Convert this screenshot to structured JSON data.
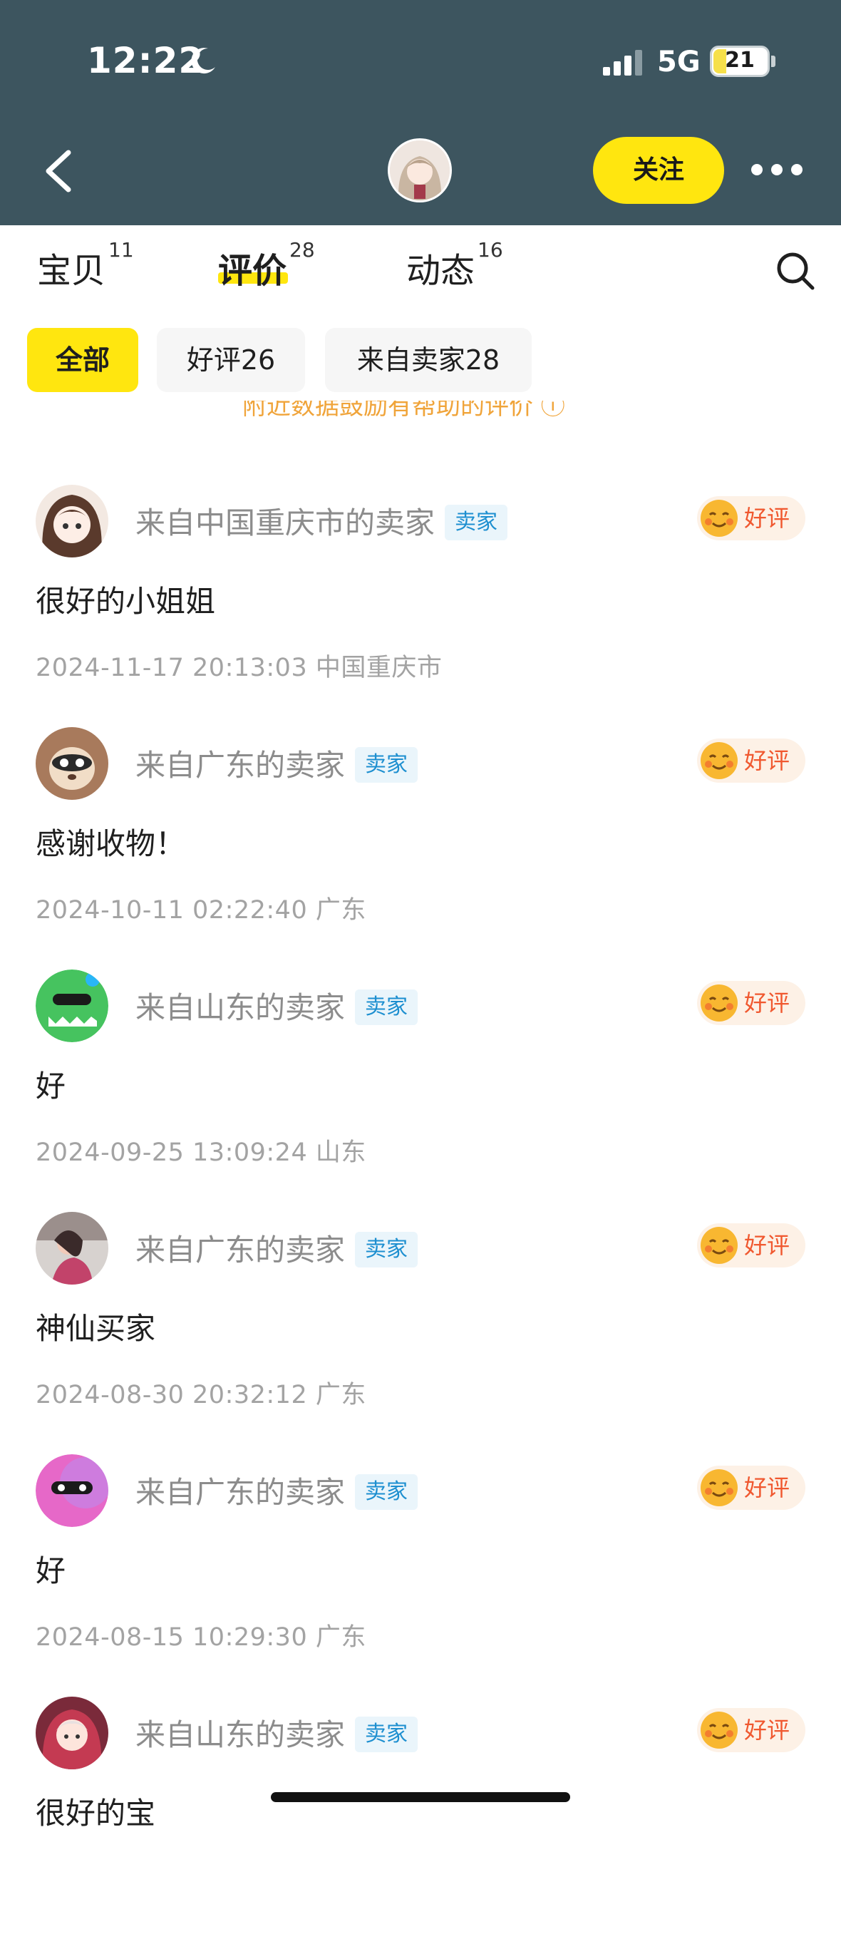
{
  "status_bar": {
    "time": "12:22",
    "network": "5G",
    "battery": "21"
  },
  "header": {
    "follow_label": "关注"
  },
  "tabs": [
    {
      "label": "宝贝",
      "count": "11"
    },
    {
      "label": "评价",
      "count": "28"
    },
    {
      "label": "动态",
      "count": "16"
    }
  ],
  "filters": [
    "全部",
    "好评26",
    "来自卖家28"
  ],
  "hint": "附近数据鼓励有帮助的评价 ⓘ",
  "reviews": [
    {
      "from": "来自中国重庆市的卖家",
      "tag": "卖家",
      "rating": "好评",
      "comment": "很好的小姐姐",
      "meta": "2024-11-17 20:13:03  中国重庆市",
      "avatar_color": "#f3e9e2"
    },
    {
      "from": "来自广东的卖家",
      "tag": "卖家",
      "rating": "好评",
      "comment": "感谢收物！",
      "meta": "2024-10-11 02:22:40  广东",
      "avatar_color": "#a87a5c"
    },
    {
      "from": "来自山东的卖家",
      "tag": "卖家",
      "rating": "好评",
      "comment": "好",
      "meta": "2024-09-25 13:09:24  山东",
      "avatar_color": "#46c35f"
    },
    {
      "from": "来自广东的卖家",
      "tag": "卖家",
      "rating": "好评",
      "comment": "神仙买家",
      "meta": "2024-08-30 20:32:12  广东",
      "avatar_color": "#6b4c5a"
    },
    {
      "from": "来自广东的卖家",
      "tag": "卖家",
      "rating": "好评",
      "comment": "好",
      "meta": "2024-08-15 10:29:30  广东",
      "avatar_color": "#e668c8"
    },
    {
      "from": "来自山东的卖家",
      "tag": "卖家",
      "rating": "好评",
      "comment": "很好的宝",
      "meta": "",
      "avatar_color": "#7a2a3a"
    }
  ]
}
